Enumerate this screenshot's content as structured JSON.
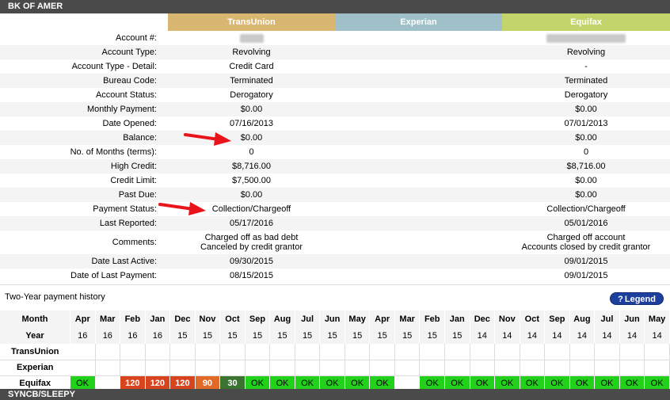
{
  "header": {
    "title": "BK OF AMER"
  },
  "bureaus": {
    "tu": "TransUnion",
    "ex": "Experian",
    "eq": "Equifax"
  },
  "rows": [
    {
      "label": "Account #:",
      "tu": "",
      "ex": "",
      "eq": ""
    },
    {
      "label": "Account Type:",
      "tu": "Revolving",
      "ex": "",
      "eq": "Revolving"
    },
    {
      "label": "Account Type - Detail:",
      "tu": "Credit Card",
      "ex": "",
      "eq": "-"
    },
    {
      "label": "Bureau Code:",
      "tu": "Terminated",
      "ex": "",
      "eq": "Terminated"
    },
    {
      "label": "Account Status:",
      "tu": "Derogatory",
      "ex": "",
      "eq": "Derogatory"
    },
    {
      "label": "Monthly Payment:",
      "tu": "$0.00",
      "ex": "",
      "eq": "$0.00"
    },
    {
      "label": "Date Opened:",
      "tu": "07/16/2013",
      "ex": "",
      "eq": "07/01/2013"
    },
    {
      "label": "Balance:",
      "tu": "$0.00",
      "ex": "",
      "eq": "$0.00"
    },
    {
      "label": "No. of Months (terms):",
      "tu": "0",
      "ex": "",
      "eq": "0"
    },
    {
      "label": "High Credit:",
      "tu": "$8,716.00",
      "ex": "",
      "eq": "$8,716.00"
    },
    {
      "label": "Credit Limit:",
      "tu": "$7,500.00",
      "ex": "",
      "eq": "$0.00"
    },
    {
      "label": "Past Due:",
      "tu": "$0.00",
      "ex": "",
      "eq": "$0.00"
    },
    {
      "label": "Payment Status:",
      "tu": "Collection/Chargeoff",
      "ex": "",
      "eq": "Collection/Chargeoff"
    },
    {
      "label": "Last Reported:",
      "tu": "05/17/2016",
      "ex": "",
      "eq": "05/01/2016"
    },
    {
      "label": "Comments:",
      "tu": [
        "Charged off as bad debt",
        "Canceled by credit grantor"
      ],
      "ex": "",
      "eq": [
        "Charged off account",
        "Accounts closed by credit grantor"
      ]
    },
    {
      "label": "Date Last Active:",
      "tu": "09/30/2015",
      "ex": "",
      "eq": "09/01/2015"
    },
    {
      "label": "Date of Last Payment:",
      "tu": "08/15/2015",
      "ex": "",
      "eq": "09/01/2015"
    }
  ],
  "history": {
    "title": "Two-Year payment history",
    "legend_label": "Legend",
    "legend_icon": "?",
    "row_labels": {
      "month": "Month",
      "year": "Year",
      "tu": "TransUnion",
      "ex": "Experian",
      "eq": "Equifax"
    },
    "months": [
      "Apr",
      "Mar",
      "Feb",
      "Jan",
      "Dec",
      "Nov",
      "Oct",
      "Sep",
      "Aug",
      "Jul",
      "Jun",
      "May",
      "Apr",
      "Mar",
      "Feb",
      "Jan",
      "Dec",
      "Nov",
      "Oct",
      "Sep",
      "Aug",
      "Jul",
      "Jun",
      "May"
    ],
    "years": [
      "16",
      "16",
      "16",
      "16",
      "15",
      "15",
      "15",
      "15",
      "15",
      "15",
      "15",
      "15",
      "15",
      "15",
      "15",
      "15",
      "14",
      "14",
      "14",
      "14",
      "14",
      "14",
      "14",
      "14"
    ],
    "equifax": [
      "OK",
      "",
      "120",
      "120",
      "120",
      "90",
      "30",
      "OK",
      "OK",
      "OK",
      "OK",
      "OK",
      "OK",
      "",
      "OK",
      "OK",
      "OK",
      "OK",
      "OK",
      "OK",
      "OK",
      "OK",
      "OK",
      "OK"
    ],
    "status_colors": {
      "ok": "#22d11a",
      "120": "#d7441d",
      "90": "#e36a26",
      "30": "#3b7330"
    }
  },
  "next_section": {
    "title": "SYNCB/SLEEPY"
  },
  "annotations": {
    "arrow_color": "#e8131b"
  }
}
